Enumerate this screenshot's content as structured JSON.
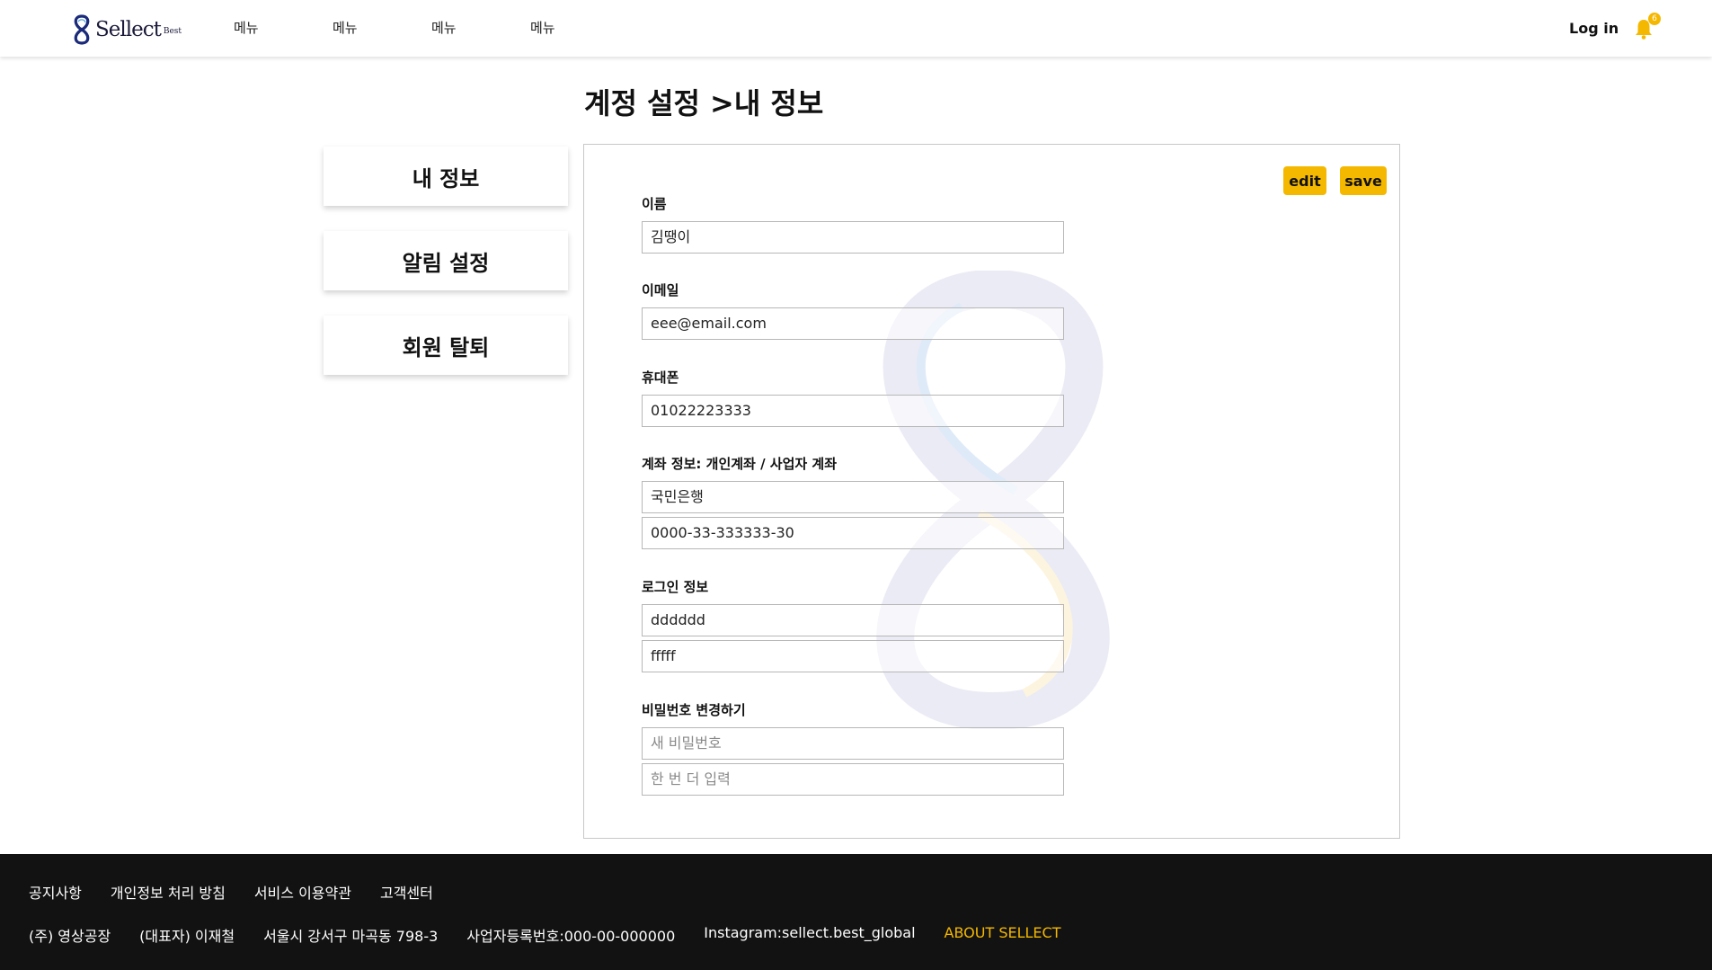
{
  "header": {
    "logo_text": "Sellect",
    "logo_sub": "Best",
    "nav": [
      "메뉴",
      "메뉴",
      "메뉴",
      "메뉴"
    ],
    "login_label": "Log in",
    "notification_count": "6",
    "accent_color": "#f5b800"
  },
  "page": {
    "title": "계정 설정 >내 정보"
  },
  "sidebar": {
    "items": [
      {
        "label": "내 정보"
      },
      {
        "label": "알림 설정"
      },
      {
        "label": "회원 탈퇴"
      }
    ]
  },
  "form": {
    "edit_label": "edit",
    "save_label": "save",
    "name": {
      "label": "이름",
      "value": "김땡이"
    },
    "email": {
      "label": "이메일",
      "value": "eee@email.com"
    },
    "phone": {
      "label": "휴대폰",
      "value": "01022223333"
    },
    "account": {
      "label": "계좌 정보: 개인계좌 / 사업자 계좌",
      "bank": "국민은행",
      "number": "0000-33-333333-30"
    },
    "login_info": {
      "label": "로그인 정보",
      "id": "dddddd",
      "password": "fffff"
    },
    "password_change": {
      "label": "비밀번호 변경하기",
      "new_placeholder": "새 비밀번호",
      "confirm_placeholder": "한 번 더 입력"
    }
  },
  "footer": {
    "links": [
      "공지사항",
      "개인정보 처리 방침",
      "서비스 이용약관",
      "고객센터"
    ],
    "company": "(주) 영상공장",
    "ceo": "(대표자) 이재철",
    "address": "서울시 강서구 마곡동 798-3",
    "business_no": "사업자등록번호:000-00-000000",
    "instagram": "Instagram:sellect.best_global",
    "about": "ABOUT SELLECT"
  }
}
